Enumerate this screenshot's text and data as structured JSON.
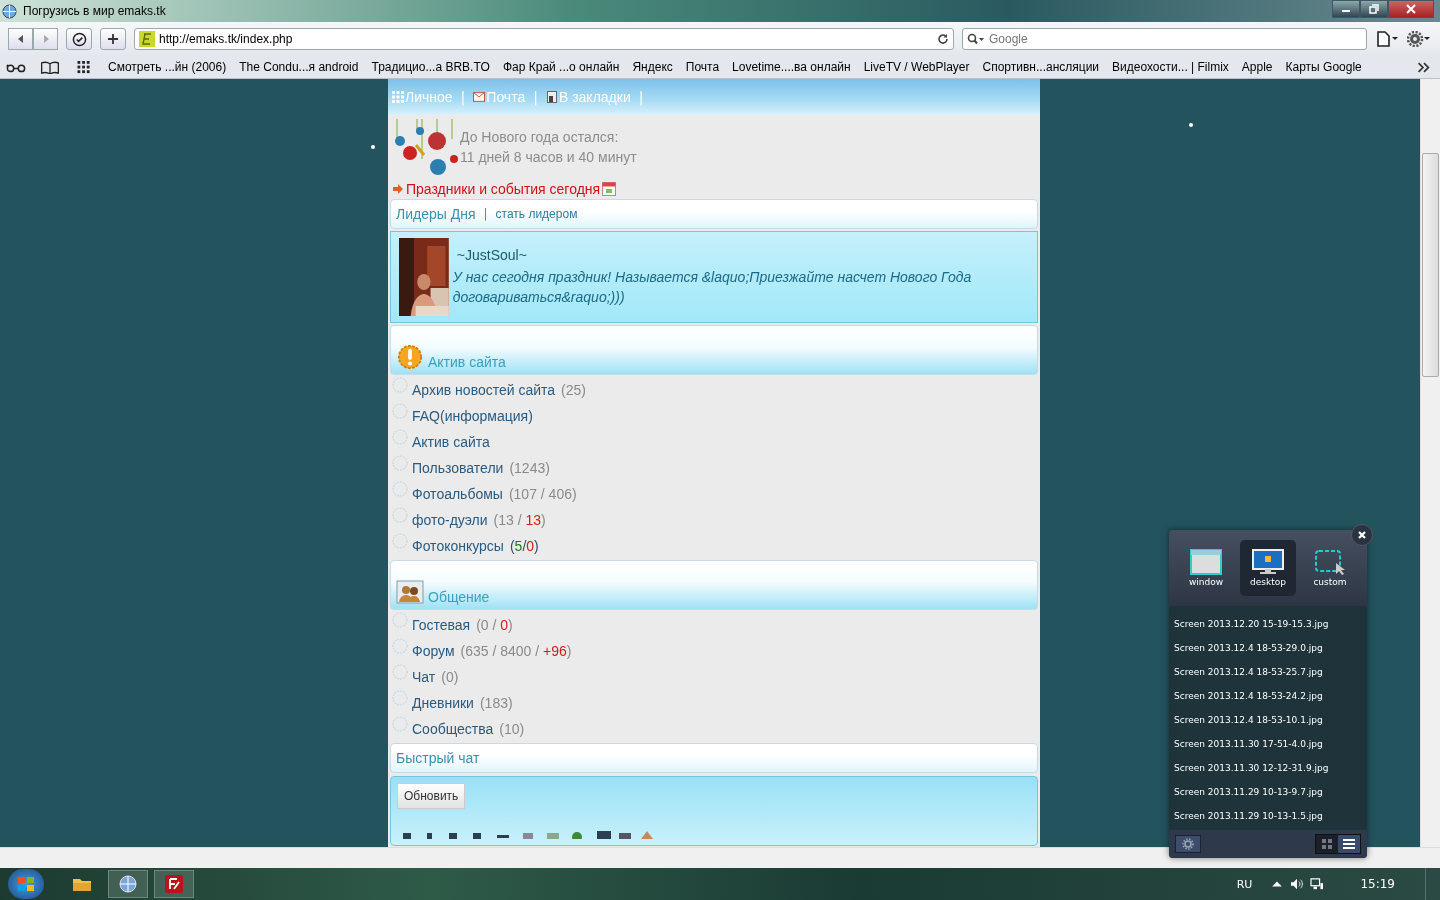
{
  "window": {
    "title": "Погрузись в мир emaks.tk"
  },
  "toolbar": {
    "url": "http://emaks.tk/index.php",
    "search": {
      "placeholder": "Google"
    }
  },
  "bookmarks": [
    {
      "label": "Смотреть ...йн (2006)"
    },
    {
      "label": "The Condu...я android"
    },
    {
      "label": "Традицио...а BRB.TO"
    },
    {
      "label": "Фар Край ...о онлайн"
    },
    {
      "label": "Яндекс"
    },
    {
      "label": "Почта"
    },
    {
      "label": "Lovetime....ва онлайн"
    },
    {
      "label": "LiveTV / WebPlayer"
    },
    {
      "label": "Спортивн...ансляции"
    },
    {
      "label": "Видеохости... | Filmix"
    },
    {
      "label": "Apple"
    },
    {
      "label": "Карты Google"
    }
  ],
  "site": {
    "nav": {
      "separator": "|",
      "items": [
        {
          "label": "Личное",
          "kind": "grid"
        },
        {
          "label": "Почта",
          "kind": "mail"
        },
        {
          "label": "В закладки",
          "kind": "bookmark"
        }
      ]
    },
    "countdown": {
      "title": "До Нового года остался:",
      "value": "11 дней 8 часов и 40 минут"
    },
    "holidays_link": "Праздники и события сегодня",
    "leaders": {
      "title": "Лидеры Дня",
      "separator": "|",
      "action": "стать лидером",
      "user": "~JustSoul~",
      "message": "У нас сегодня праздник! Называется &laquo;Приезжайте насчет Нового Года договариваться&raquo;)))"
    },
    "sections": [
      {
        "title": "Актив сайта",
        "kind": "alert",
        "items": [
          {
            "label": "Архив новостей сайта",
            "count": [
              {
                "text": "(25)",
                "kind": "plain"
              }
            ]
          },
          {
            "label": "FAQ(информация)"
          },
          {
            "label": "Актив сайта"
          },
          {
            "label": "Пользователи",
            "count": [
              {
                "text": "(1243)",
                "kind": "plain"
              }
            ]
          },
          {
            "label": "Фотоальбомы",
            "count": [
              {
                "text": "(107 / 406)",
                "kind": "plain"
              }
            ]
          },
          {
            "label": "фото-дуэли",
            "count": [
              {
                "text": "(13 / ",
                "kind": "plain"
              },
              {
                "text": "13",
                "kind": "new"
              },
              {
                "text": ")",
                "kind": "plain"
              }
            ]
          },
          {
            "label": "Фотоконкурсы",
            "count": [
              {
                "text": "(",
                "kind": "dark"
              },
              {
                "text": "5",
                "kind": "good"
              },
              {
                "text": "/",
                "kind": "dark"
              },
              {
                "text": "0",
                "kind": "new"
              },
              {
                "text": ")",
                "kind": "dark"
              }
            ]
          }
        ]
      },
      {
        "title": "Общение",
        "kind": "people",
        "items": [
          {
            "label": "Гостевая",
            "count": [
              {
                "text": "(0 / ",
                "kind": "plain"
              },
              {
                "text": "0",
                "kind": "new"
              },
              {
                "text": ")",
                "kind": "plain"
              }
            ]
          },
          {
            "label": "Форум",
            "count": [
              {
                "text": "(635 / 8400 / ",
                "kind": "plain"
              },
              {
                "text": "+96",
                "kind": "new"
              },
              {
                "text": ")",
                "kind": "plain"
              }
            ]
          },
          {
            "label": "Чат",
            "count": [
              {
                "text": "(0)",
                "kind": "plain"
              }
            ]
          },
          {
            "label": "Дневники",
            "count": [
              {
                "text": "(183)",
                "kind": "plain"
              }
            ]
          },
          {
            "label": "Сообщества",
            "count": [
              {
                "text": "(10)",
                "kind": "plain"
              }
            ]
          }
        ]
      }
    ],
    "chat": {
      "title": "Быстрый чат",
      "button": "Обновить"
    }
  },
  "capture_tool": {
    "modes": [
      {
        "label": "window",
        "kind": "window",
        "selected": false
      },
      {
        "label": "desktop",
        "kind": "desktop",
        "selected": true
      },
      {
        "label": "custom",
        "kind": "custom",
        "selected": false
      }
    ],
    "files": [
      "Screen 2013.12.20 15-19-15.3.jpg",
      "Screen 2013.12.4 18-53-29.0.jpg",
      "Screen 2013.12.4 18-53-25.7.jpg",
      "Screen 2013.12.4 18-53-24.2.jpg",
      "Screen 2013.12.4 18-53-10.1.jpg",
      "Screen 2013.11.30 17-51-4.0.jpg",
      "Screen 2013.11.30 12-12-31.9.jpg",
      "Screen 2013.11.29 10-13-9.7.jpg",
      "Screen 2013.11.29 10-13-1.5.jpg"
    ],
    "views": [
      {
        "kind": "grid",
        "selected": false
      },
      {
        "kind": "list",
        "selected": true
      }
    ]
  },
  "taskbar": {
    "language": "RU",
    "time": "15:19"
  }
}
